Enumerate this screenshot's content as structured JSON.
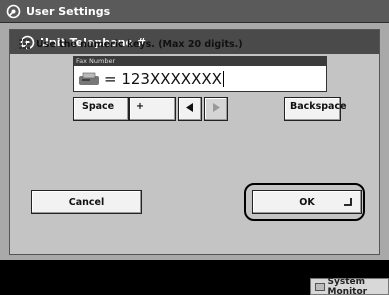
{
  "window": {
    "title": "User Settings",
    "icon": "wrench-gear-icon"
  },
  "dialog": {
    "title": "Unit Telephone #",
    "icon": "wrench-gear-icon",
    "instruction": "Use the numeric keys. (Max 20 digits.)",
    "instruction_icon": "numeric-keys-icon",
    "fax_field": {
      "label": "Fax Number",
      "value": "= 123XXXXXXX",
      "icon": "fax-machine-icon"
    },
    "keys": {
      "space": "Space",
      "plus": "+",
      "backspace": "Backspace"
    },
    "cancel_label": "Cancel",
    "ok_label": "OK"
  },
  "status_bar": {
    "system_monitor_label": "System Monitor"
  }
}
